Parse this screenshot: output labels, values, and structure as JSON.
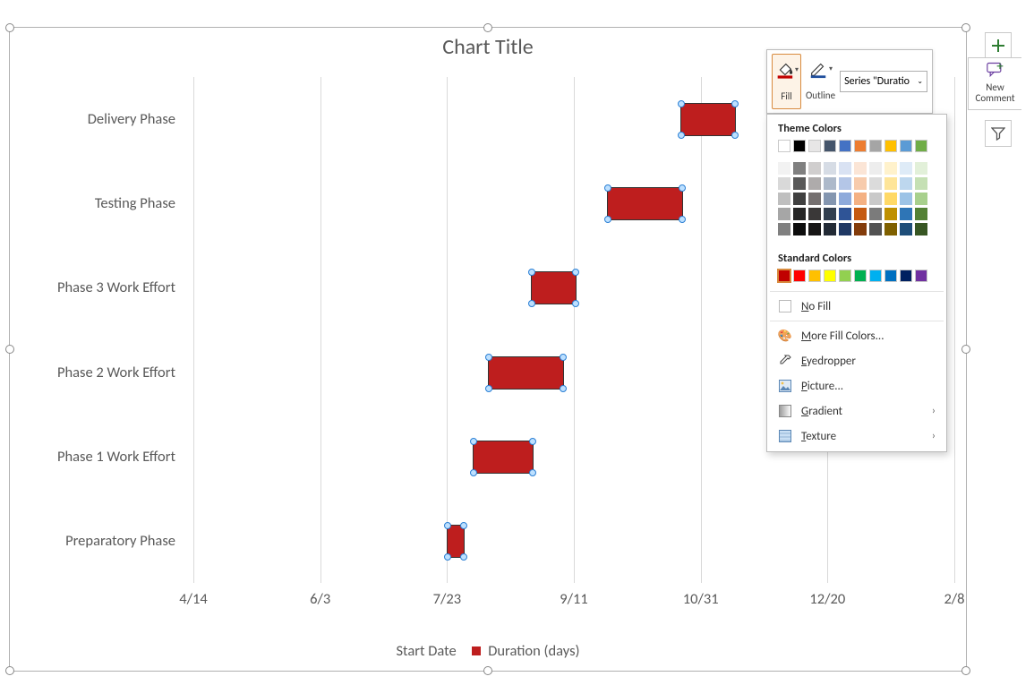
{
  "chart_data": {
    "type": "bar",
    "orientation": "horizontal",
    "title": "Chart Title",
    "xlabel": "",
    "ylabel": "",
    "x_axis": {
      "type": "date",
      "ticks": [
        "4/14",
        "6/3",
        "7/23",
        "9/11",
        "10/31",
        "12/20",
        "2/8"
      ],
      "range_days": [
        0,
        300
      ]
    },
    "categories": [
      "Delivery Phase",
      "Testing Phase",
      "Phase 3 Work Effort",
      "Phase 2 Work Effort",
      "Phase 1 Work Effort",
      "Preparatory Phase"
    ],
    "series": [
      {
        "name": "Start Date",
        "role": "offset_transparent",
        "values_days_from_4_14": [
          192,
          163,
          133,
          116,
          110,
          100
        ]
      },
      {
        "name": "Duration (days)",
        "color": "#be1e1e",
        "values": [
          22,
          30,
          18,
          30,
          24,
          7
        ]
      }
    ],
    "legend": [
      "Start Date",
      "Duration (days)"
    ],
    "selected_series": "Duration (days)"
  },
  "mini_toolbar": {
    "fill_label": "Fill",
    "outline_label": "Outline",
    "series_select_text": "Series \"Duratio"
  },
  "fill_panel": {
    "theme_heading": "Theme Colors",
    "theme_row": [
      "#ffffff",
      "#000000",
      "#e7e6e6",
      "#44546a",
      "#4472c4",
      "#ed7d31",
      "#a5a5a5",
      "#ffc000",
      "#5b9bd5",
      "#70ad47"
    ],
    "tints": [
      [
        "#f2f2f2",
        "#808080",
        "#d0cece",
        "#d6dce5",
        "#d9e2f3",
        "#fbe5d6",
        "#ededed",
        "#fff2cc",
        "#deebf7",
        "#e2f0d9"
      ],
      [
        "#d9d9d9",
        "#595959",
        "#aeabab",
        "#adb9ca",
        "#b4c6e7",
        "#f7cbac",
        "#dbdbdb",
        "#fee599",
        "#bdd7ee",
        "#c5e0b4"
      ],
      [
        "#bfbfbf",
        "#404040",
        "#757070",
        "#8496b0",
        "#8eaadb",
        "#f4b183",
        "#c9c9c9",
        "#ffd966",
        "#9cc3e6",
        "#a8d08d"
      ],
      [
        "#a6a6a6",
        "#262626",
        "#3a3838",
        "#323f4f",
        "#2f5496",
        "#c55a11",
        "#7b7b7b",
        "#bf9000",
        "#2e75b6",
        "#538135"
      ],
      [
        "#808080",
        "#0d0d0d",
        "#171616",
        "#222a35",
        "#1f3864",
        "#833c0b",
        "#525252",
        "#7f6000",
        "#1e4e79",
        "#375623"
      ]
    ],
    "standard_heading": "Standard Colors",
    "standard": [
      "#c00000",
      "#ff0000",
      "#ffc000",
      "#ffff00",
      "#92d050",
      "#00b050",
      "#00b0f0",
      "#0070c0",
      "#002060",
      "#7030a0"
    ],
    "selected_standard_index": 0,
    "no_fill": "No Fill",
    "more_colors": "More Fill Colors...",
    "eyedropper": "Eyedropper",
    "picture": "Picture...",
    "gradient": "Gradient",
    "texture": "Texture"
  },
  "side_buttons": {
    "new_comment": "New Comment"
  }
}
